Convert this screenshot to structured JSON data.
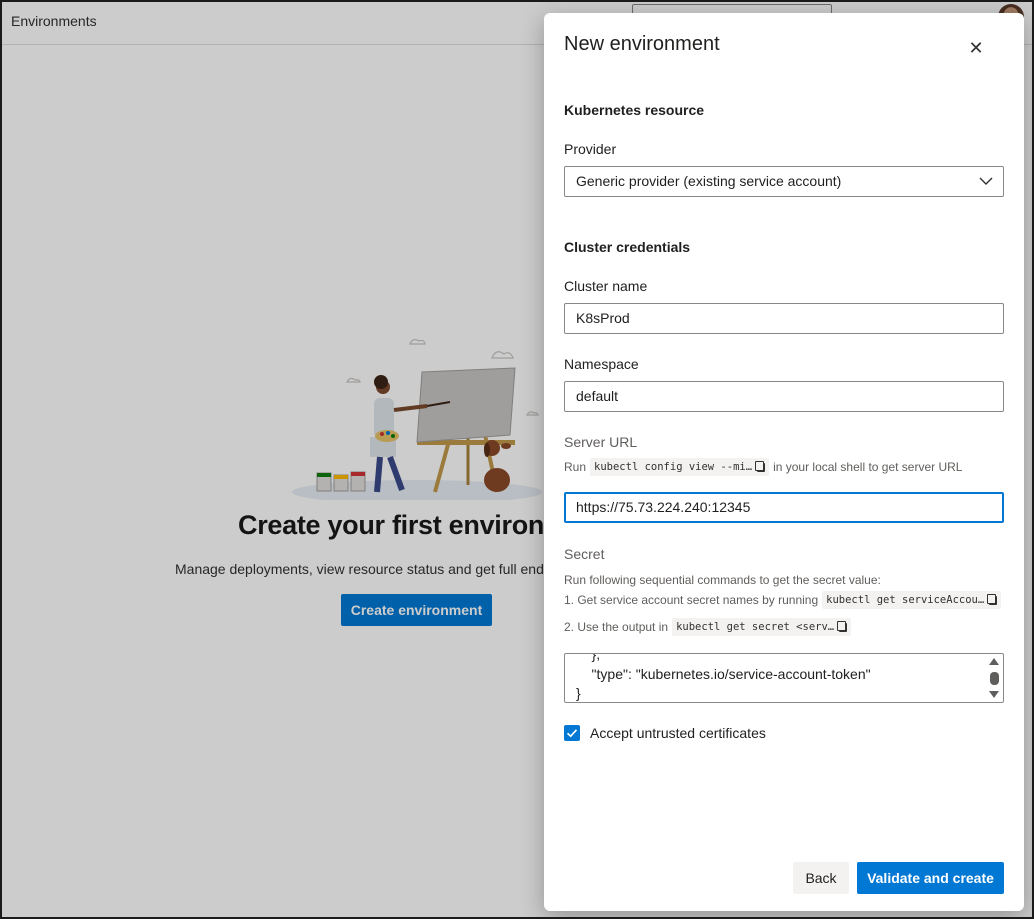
{
  "page": {
    "title": "Environments"
  },
  "empty_state": {
    "title": "Create your first environm",
    "description": "Manage deployments, view resource status and get full end",
    "create_button": "Create environment"
  },
  "panel": {
    "title": "New environment",
    "close_icon": "close-icon",
    "kubernetes": {
      "section_title": "Kubernetes resource",
      "provider_label": "Provider",
      "provider_value": "Generic provider (existing service account)"
    },
    "credentials": {
      "section_title": "Cluster credentials",
      "cluster_name_label": "Cluster name",
      "cluster_name_value": "K8sProd",
      "namespace_label": "Namespace",
      "namespace_value": "default",
      "server_url_label": "Server URL",
      "server_url_help_prefix": "Run",
      "server_url_help_code": "kubectl config view --mi…",
      "server_url_help_suffix": "in your local shell to get server URL",
      "server_url_value": "https://75.73.224.240:12345",
      "secret_label": "Secret",
      "secret_help": "Run following sequential commands to get the secret value:",
      "secret_step1_prefix": "1. Get service account secret names by running",
      "secret_step1_code": "kubectl get serviceAccou…",
      "secret_step2_prefix": "2. Use the output in",
      "secret_step2_code": "kubectl get secret <serv…",
      "secret_lines": [
        "    },",
        "    \"type\": \"kubernetes.io/service-account-token\"",
        "}"
      ]
    },
    "accept_untrusted": {
      "label": "Accept untrusted certificates",
      "checked": true
    },
    "back_button": "Back",
    "primary_button": "Validate and create"
  },
  "colors": {
    "accent": "#0078d4",
    "overlay": "rgba(0,0,0,0.2)"
  }
}
